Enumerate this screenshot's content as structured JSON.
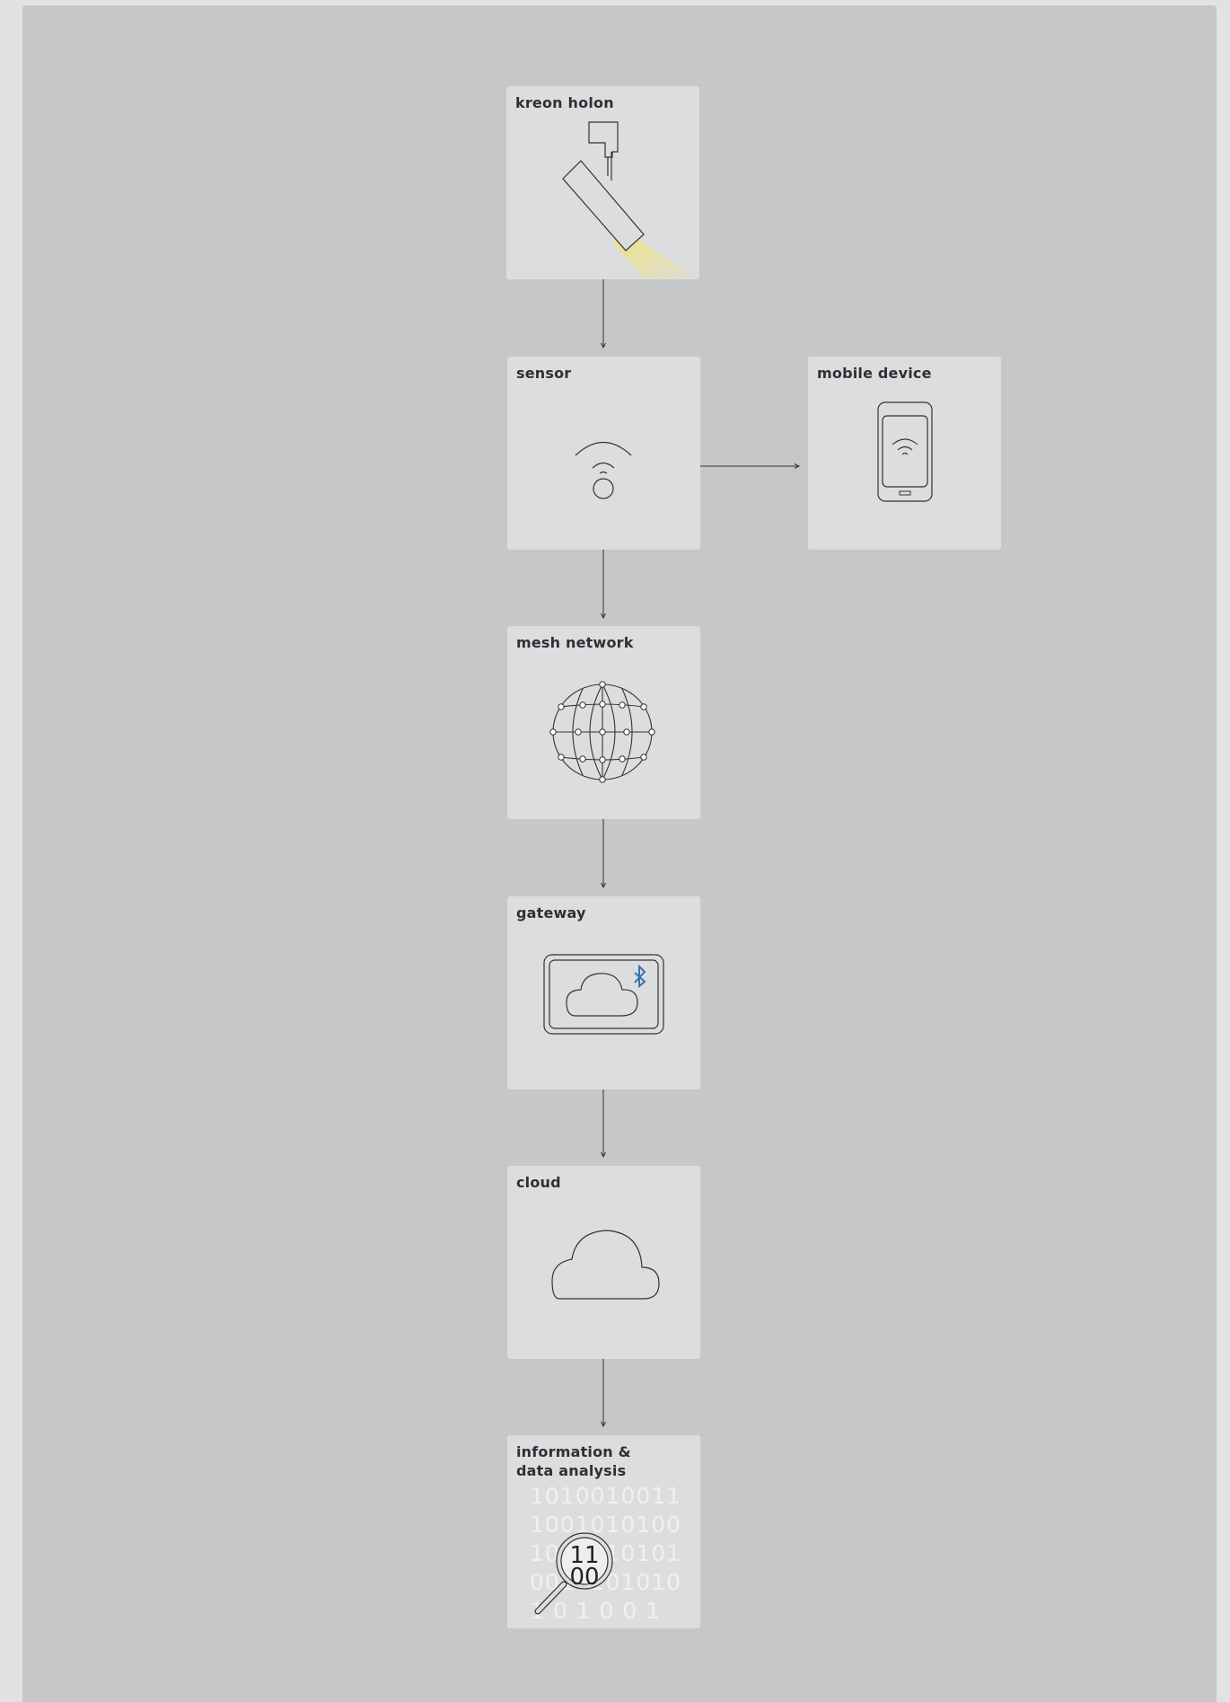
{
  "nodes": {
    "holon": "kreon holon",
    "sensor": "sensor",
    "mobile": "mobile device",
    "mesh": "mesh network",
    "gateway": "gateway",
    "cloud": "cloud",
    "analysis": "information &\ndata analysis"
  },
  "binary_lines": [
    "1010010011",
    "1001010100",
    "1011010101",
    "0010101010",
    "1 0 1 0 0 1"
  ],
  "magnifier_digits": "11\n00",
  "colors": {
    "background": "#c6c7c9",
    "card": "#dcdddf",
    "line": "#333333",
    "light_beam": "#efe37a",
    "bluetooth": "#3b6fb6"
  },
  "icons": [
    "spotlight-icon",
    "wireless-sensor-icon",
    "smartphone-icon",
    "globe-mesh-icon",
    "gateway-cloud-icon",
    "bluetooth-icon",
    "cloud-icon",
    "magnifier-icon"
  ]
}
